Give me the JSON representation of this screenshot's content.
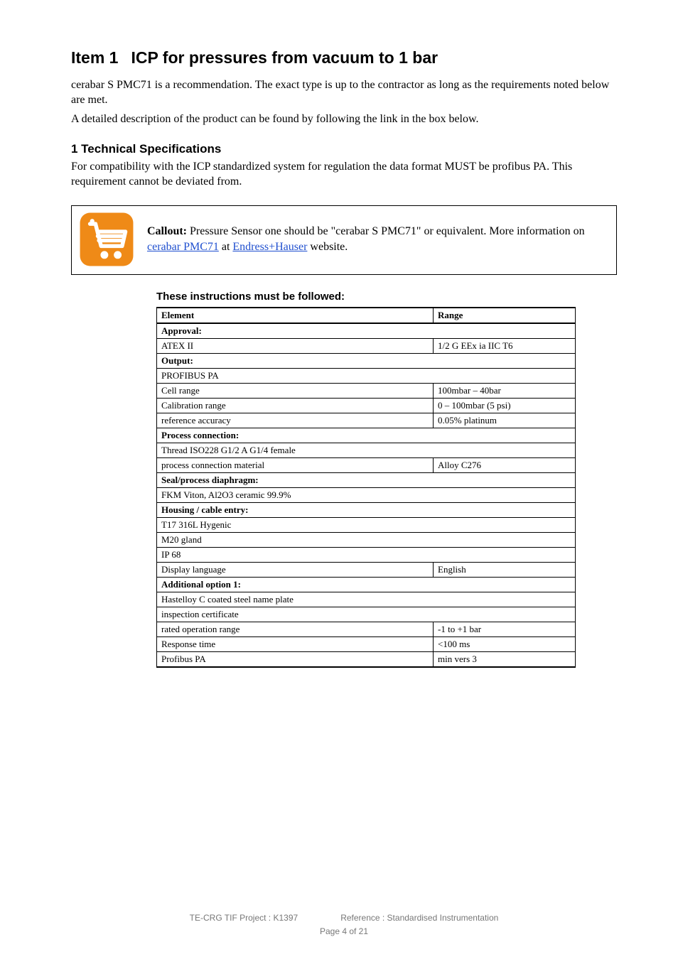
{
  "heading": {
    "item": "Item 1",
    "title": "ICP for pressures from vacuum to 1 bar"
  },
  "intro": {
    "p1": "cerabar S PMC71 is a recommendation. The exact type is up to the contractor as long as the requirements noted below are met.",
    "p2": "A detailed description of the product can be found by following the link in the box below."
  },
  "section": {
    "header": "1  Technical Specifications",
    "text": "For compatibility with the ICP standardized system for regulation the data format MUST be profibus PA. This requirement cannot be deviated from."
  },
  "callout": {
    "label": "Callout:",
    "text_prefix": "Pressure Sensor one should be \"cerabar S PMC71\" or equivalent. More information on ",
    "link1_label": "cerabar PMC71",
    "middle": " at ",
    "link2_label": "Endress+Hauser",
    "text_suffix": " website."
  },
  "followed_header": "These instructions must be followed:",
  "table": {
    "headers": [
      "Element",
      "Range"
    ],
    "groups": [
      {
        "group": "Approval:",
        "rows": [
          [
            "ATEX II",
            "1/2 G EEx ia IIC T6"
          ]
        ]
      },
      {
        "group": "Output:",
        "rows": [
          [
            "PROFIBUS PA",
            ""
          ],
          [
            "Cell range",
            "100mbar – 40bar"
          ],
          [
            "Calibration range",
            "0 – 100mbar (5 psi)"
          ],
          [
            "reference accuracy",
            "0.05% platinum"
          ]
        ]
      },
      {
        "group": "Process connection:",
        "rows": [
          [
            "Thread ISO228 G1/2 A G1/4 female",
            ""
          ],
          [
            "process connection material",
            "Alloy C276"
          ]
        ]
      },
      {
        "group": "Seal/process diaphragm:",
        "rows": [
          [
            "FKM Viton, Al2O3 ceramic 99.9%",
            ""
          ]
        ]
      },
      {
        "group": "Housing / cable entry:",
        "rows": [
          [
            "T17 316L Hygenic",
            ""
          ],
          [
            "M20 gland",
            ""
          ],
          [
            "IP 68",
            ""
          ],
          [
            "Display language",
            "English"
          ]
        ]
      },
      {
        "group": "Additional option 1:",
        "rows": [
          [
            "Hastelloy C coated steel name plate",
            ""
          ],
          [
            "inspection certificate",
            ""
          ],
          [
            "rated operation range",
            "-1 to +1 bar"
          ],
          [
            "Response time",
            "<100 ms"
          ],
          [
            "Profibus PA",
            "min vers 3"
          ]
        ]
      }
    ]
  },
  "footer": {
    "project": "TE-CRG TIF Project : K1397",
    "reference": "Reference : Standardised Instrumentation",
    "page": "Page 4 of 21"
  }
}
